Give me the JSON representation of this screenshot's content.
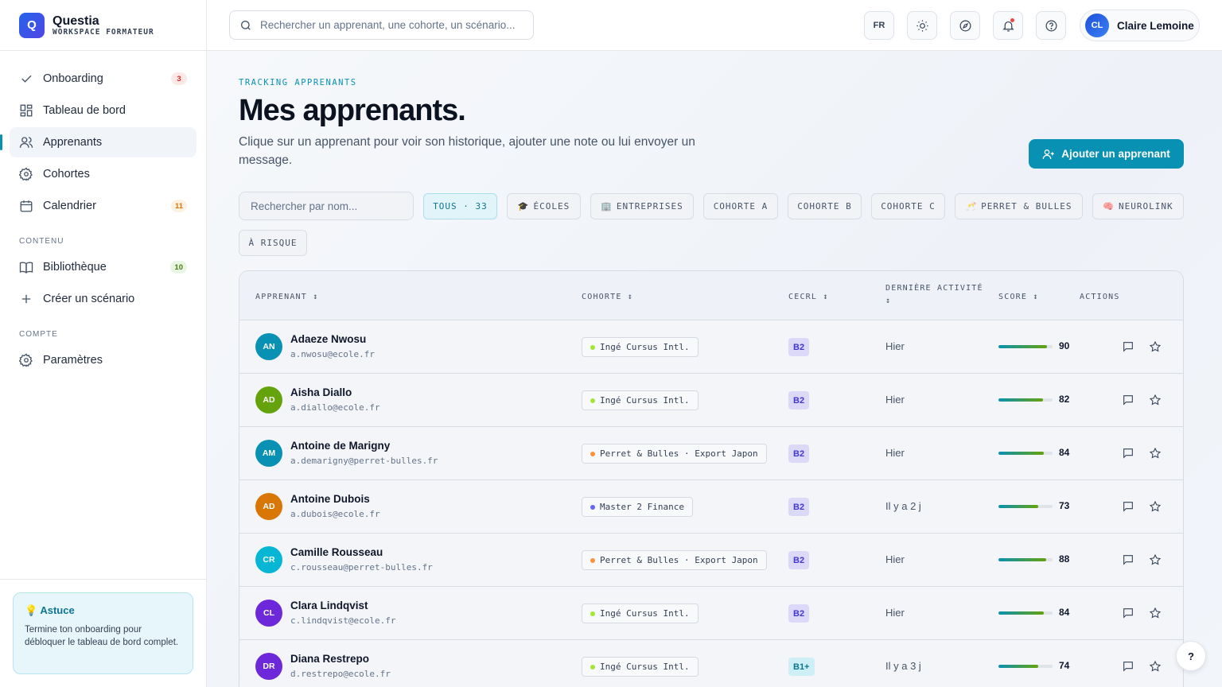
{
  "brand": {
    "logo": "Q",
    "name": "Questia",
    "subtitle": "WORKSPACE FORMATEUR"
  },
  "nav": {
    "items": [
      {
        "label": "Onboarding",
        "badge": "3",
        "icon": "check-icon"
      },
      {
        "label": "Tableau de bord",
        "badge": "",
        "icon": "dashboard-icon"
      },
      {
        "label": "Apprenants",
        "badge": "",
        "icon": "users-icon",
        "active": true
      },
      {
        "label": "Cohortes",
        "badge": "",
        "icon": "gear-icon"
      },
      {
        "label": "Calendrier",
        "badge": "11",
        "icon": "calendar-icon"
      }
    ],
    "section_content": "CONTENU",
    "content_items": [
      {
        "label": "Bibliothèque",
        "badge": "10",
        "icon": "book-icon"
      },
      {
        "label": "Créer un scénario",
        "badge": "",
        "icon": "plus-icon"
      }
    ],
    "section_account": "COMPTE",
    "account_items": [
      {
        "label": "Paramètres",
        "icon": "gear-icon"
      }
    ]
  },
  "tip": {
    "icon": "💡",
    "title": "Astuce",
    "text": "Termine ton onboarding pour débloquer le tableau de bord complet."
  },
  "topbar": {
    "search_placeholder": "Rechercher un apprenant, une cohorte, un scénario...",
    "lang": "FR",
    "user": {
      "initials": "CL",
      "name": "Claire Lemoine"
    }
  },
  "page": {
    "eyebrow": "TRACKING APPRENANTS",
    "title": "Mes apprenants.",
    "description": "Clique sur un apprenant pour voir son historique, ajouter une note ou lui envoyer un message.",
    "add_button": "Ajouter un apprenant"
  },
  "filters": {
    "search_placeholder": "Rechercher par nom...",
    "chips": [
      {
        "label": "TOUS · 33",
        "icon": "",
        "active": true
      },
      {
        "label": "ÉCOLES",
        "icon": "🎓"
      },
      {
        "label": "ENTREPRISES",
        "icon": "🏢"
      },
      {
        "label": "COHORTE A",
        "icon": ""
      },
      {
        "label": "COHORTE B",
        "icon": ""
      },
      {
        "label": "COHORTE C",
        "icon": ""
      },
      {
        "label": "PERRET & BULLES",
        "icon": "🥂"
      },
      {
        "label": "NEUROLINK",
        "icon": "🧠"
      },
      {
        "label": "À RISQUE",
        "icon": ""
      }
    ]
  },
  "table": {
    "headers": {
      "learner": "APPRENANT ↕",
      "cohort": "COHORTE ↕",
      "cecrl": "CECRL ↕",
      "activity_l1": "DERNIÈRE ACTIVITÉ",
      "activity_l2": "↕",
      "score": "SCORE ↕",
      "actions": "ACTIONS"
    },
    "rows": [
      {
        "initials": "AN",
        "name": "Adaeze Nwosu",
        "email": "a.nwosu@ecole.fr",
        "cohort": "Ingé Cursus Intl.",
        "cohort_color": "#a3e635",
        "cecrl": "B2",
        "activity": "Hier",
        "score": 90,
        "avatar": "#0891b2"
      },
      {
        "initials": "AD",
        "name": "Aisha Diallo",
        "email": "a.diallo@ecole.fr",
        "cohort": "Ingé Cursus Intl.",
        "cohort_color": "#a3e635",
        "cecrl": "B2",
        "activity": "Hier",
        "score": 82,
        "avatar": "#65a30d"
      },
      {
        "initials": "AM",
        "name": "Antoine de Marigny",
        "email": "a.demarigny@perret-bulles.fr",
        "cohort": "Perret & Bulles · Export Japon",
        "cohort_color": "#fb923c",
        "cecrl": "B2",
        "activity": "Hier",
        "score": 84,
        "avatar": "#0891b2"
      },
      {
        "initials": "AD",
        "name": "Antoine Dubois",
        "email": "a.dubois@ecole.fr",
        "cohort": "Master 2 Finance",
        "cohort_color": "#6366f1",
        "cecrl": "B2",
        "activity": "Il y a 2 j",
        "score": 73,
        "avatar": "#d97706"
      },
      {
        "initials": "CR",
        "name": "Camille Rousseau",
        "email": "c.rousseau@perret-bulles.fr",
        "cohort": "Perret & Bulles · Export Japon",
        "cohort_color": "#fb923c",
        "cecrl": "B2",
        "activity": "Hier",
        "score": 88,
        "avatar": "#06b6d4"
      },
      {
        "initials": "CL",
        "name": "Clara Lindqvist",
        "email": "c.lindqvist@ecole.fr",
        "cohort": "Ingé Cursus Intl.",
        "cohort_color": "#a3e635",
        "cecrl": "B2",
        "activity": "Hier",
        "score": 84,
        "avatar": "#6d28d9"
      },
      {
        "initials": "DR",
        "name": "Diana Restrepo",
        "email": "d.restrepo@ecole.fr",
        "cohort": "Ingé Cursus Intl.",
        "cohort_color": "#a3e635",
        "cecrl": "B1+",
        "activity": "Il y a 3 j",
        "score": 74,
        "avatar": "#6d28d9"
      }
    ]
  },
  "help": "?"
}
